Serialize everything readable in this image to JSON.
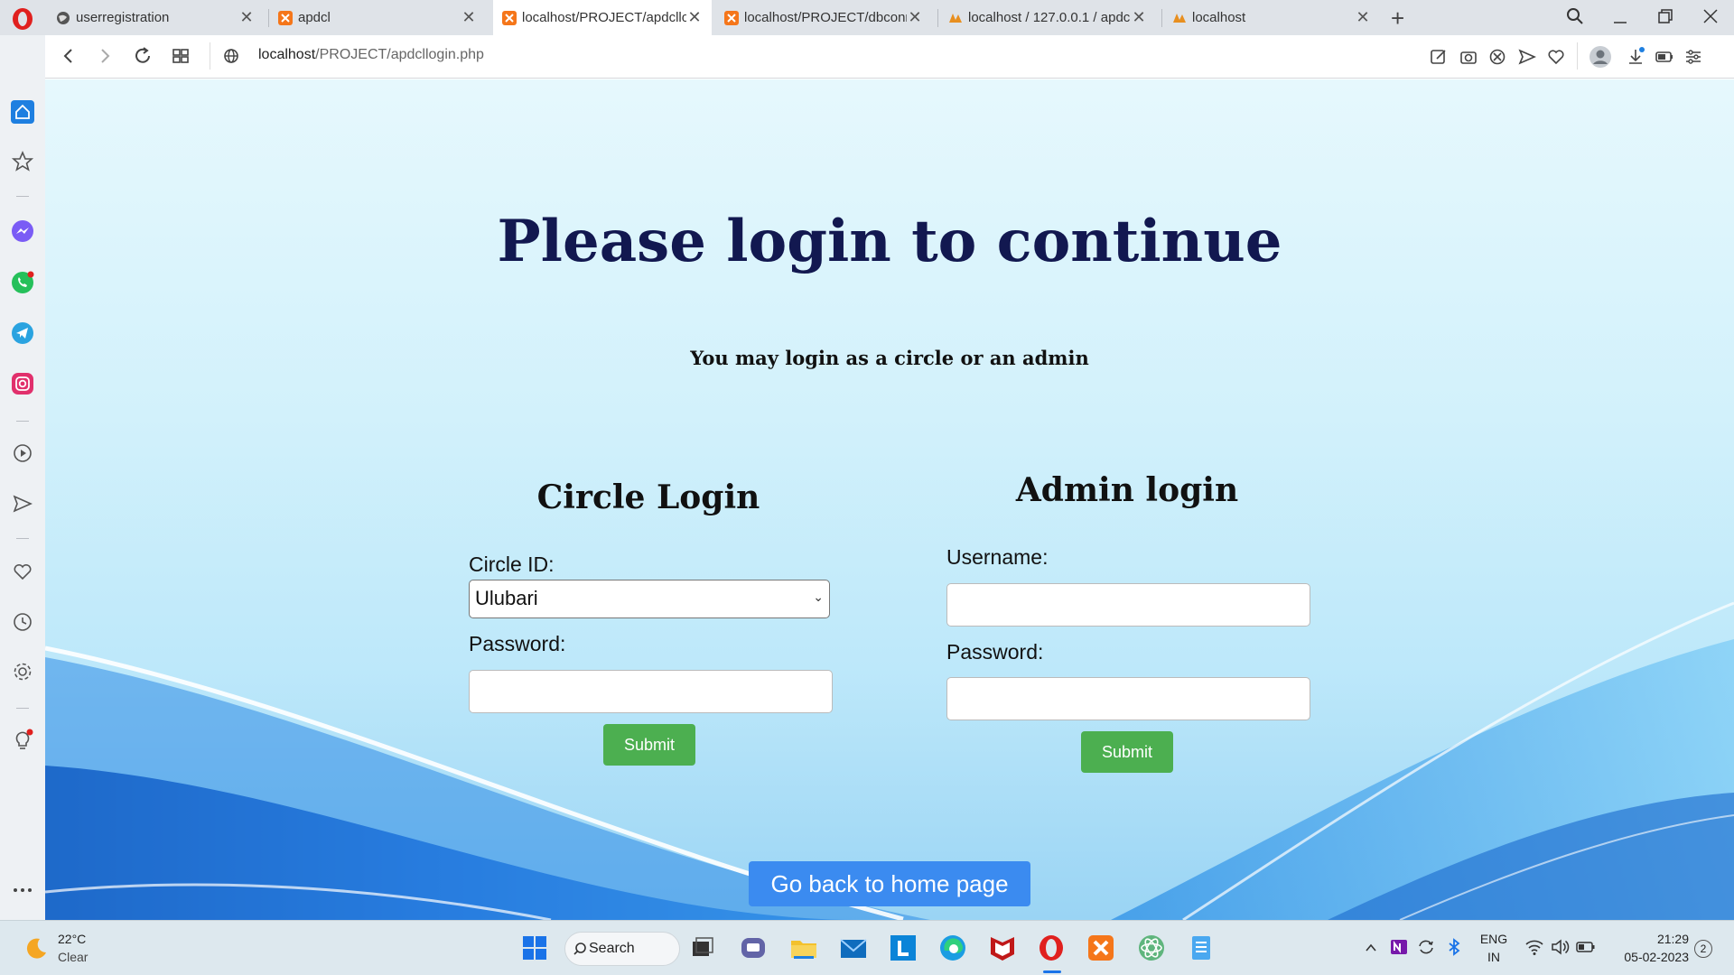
{
  "browser": {
    "tabs": [
      {
        "title": "userregistration",
        "active": false
      },
      {
        "title": "apdcl",
        "active": false
      },
      {
        "title": "localhost/PROJECT/apdcllo",
        "active": true
      },
      {
        "title": "localhost/PROJECT/dbconn",
        "active": false
      },
      {
        "title": "localhost / 127.0.0.1 / apdc",
        "active": false
      },
      {
        "title": "localhost",
        "active": false
      }
    ],
    "address": {
      "host": "localhost",
      "path": "/PROJECT/apdcllogin.php"
    }
  },
  "page": {
    "heading": "Please login to continue",
    "subtitle": "You may login as a circle or an admin",
    "circle": {
      "title": "Circle Login",
      "circle_id_label": "Circle ID:",
      "circle_id_value": "Ulubari",
      "password_label": "Password:",
      "submit_label": "Submit"
    },
    "admin": {
      "title": "Admin login",
      "username_label": "Username:",
      "password_label": "Password:",
      "submit_label": "Submit"
    },
    "home_button": "Go back to home page"
  },
  "taskbar": {
    "weather_temp": "22°C",
    "weather_cond": "Clear",
    "search_label": "Search",
    "lang_top": "ENG",
    "lang_bottom": "IN",
    "time": "21:29",
    "date": "05-02-2023",
    "notification_count": "2"
  },
  "colors": {
    "heading": "#121850",
    "submit": "#4caf50",
    "home_button": "#3b8bf0",
    "opera_red": "#e0201e"
  }
}
